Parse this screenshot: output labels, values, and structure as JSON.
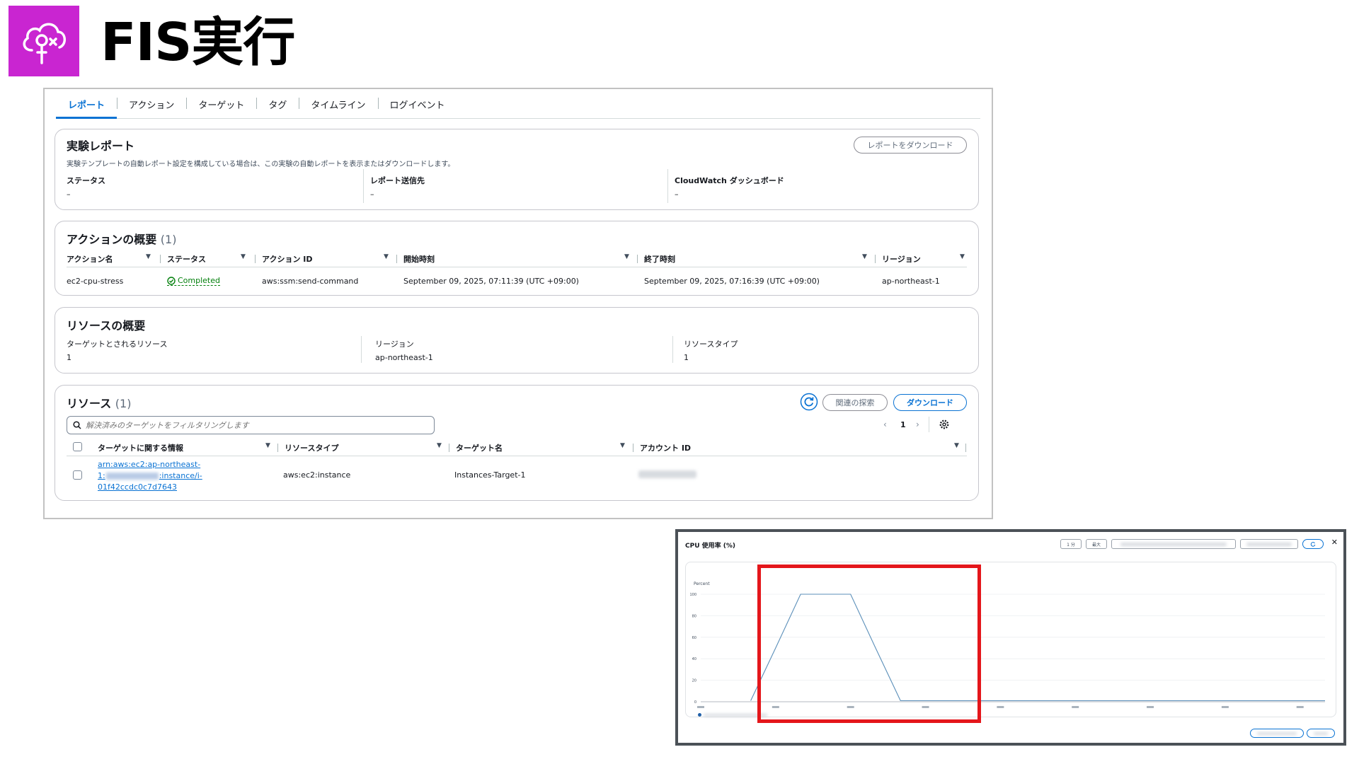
{
  "header": {
    "title": "FIS実行",
    "logo_icon": "fis-cloud-icon",
    "logo_color": "#c925d1"
  },
  "tabs": [
    {
      "label": "レポート",
      "active": true
    },
    {
      "label": "アクション",
      "active": false
    },
    {
      "label": "ターゲット",
      "active": false
    },
    {
      "label": "タグ",
      "active": false
    },
    {
      "label": "タイムライン",
      "active": false
    },
    {
      "label": "ログイベント",
      "active": false
    }
  ],
  "report": {
    "title": "実験レポート",
    "download_button": "レポートをダウンロード",
    "description": "実験テンプレートの自動レポート設定を構成している場合は、この実験の自動レポートを表示またはダウンロードします。",
    "fields": [
      {
        "label": "ステータス",
        "value": "–"
      },
      {
        "label": "レポート送信先",
        "value": "–"
      },
      {
        "label": "CloudWatch ダッシュボード",
        "value": "–"
      }
    ]
  },
  "actions_summary": {
    "title": "アクションの概要",
    "count": "(1)",
    "columns": [
      "アクション名",
      "ステータス",
      "アクション ID",
      "開始時刻",
      "終了時刻",
      "リージョン"
    ],
    "rows": [
      {
        "name": "ec2-cpu-stress",
        "status": "Completed",
        "action_id": "aws:ssm:send-command",
        "start": "September 09, 2025, 07:11:39 (UTC +09:00)",
        "end": "September 09, 2025, 07:16:39 (UTC +09:00)",
        "region": "ap-northeast-1"
      }
    ]
  },
  "resource_summary": {
    "title": "リソースの概要",
    "fields": [
      {
        "label": "ターゲットとされるリソース",
        "value": "1"
      },
      {
        "label": "リージョン",
        "value": "ap-northeast-1"
      },
      {
        "label": "リソースタイプ",
        "value": "1"
      }
    ]
  },
  "resources": {
    "title": "リソース",
    "count": "(1)",
    "explore_button": "関連の探索",
    "download_button": "ダウンロード",
    "search_placeholder": "解決済みのターゲットをフィルタリングします",
    "page": "1",
    "columns": [
      "ターゲットに関する情報",
      "リソースタイプ",
      "ターゲット名",
      "アカウント ID"
    ],
    "rows": [
      {
        "arn_line1": "arn:aws:ec2:ap-northeast-",
        "arn_line2_prefix": "1:",
        "arn_line2_suffix": ":instance/i-",
        "arn_line3": "01f42ccdc0c7d7643",
        "resource_type": "aws:ec2:instance",
        "target_name": "Instances-Target-1"
      }
    ]
  },
  "cloudwatch": {
    "title": "CPU 使用率 (%)",
    "ylabel": "Percent",
    "controls": [
      "1 分",
      "最大"
    ],
    "highlight_color": "#e4161b",
    "chart_data": {
      "type": "line",
      "title": "CPU 使用率 (%)",
      "ylabel": "Percent",
      "ylim": [
        0,
        100
      ],
      "yticks": [
        0,
        20,
        40,
        60,
        80,
        100
      ],
      "grid": true,
      "x": [
        0,
        1,
        2,
        3,
        4,
        5,
        6,
        7,
        8,
        9,
        10,
        11,
        12,
        13,
        14,
        15,
        16,
        17,
        18,
        19,
        20,
        21,
        22,
        23,
        24,
        25
      ],
      "series": [
        {
          "color": "#5b8fb9",
          "values": [
            null,
            null,
            1,
            50,
            100,
            100,
            100,
            50,
            1,
            1,
            1,
            1,
            1,
            1,
            1,
            1,
            1,
            1,
            1,
            1,
            1,
            1,
            1,
            1,
            1,
            1
          ]
        }
      ]
    }
  }
}
